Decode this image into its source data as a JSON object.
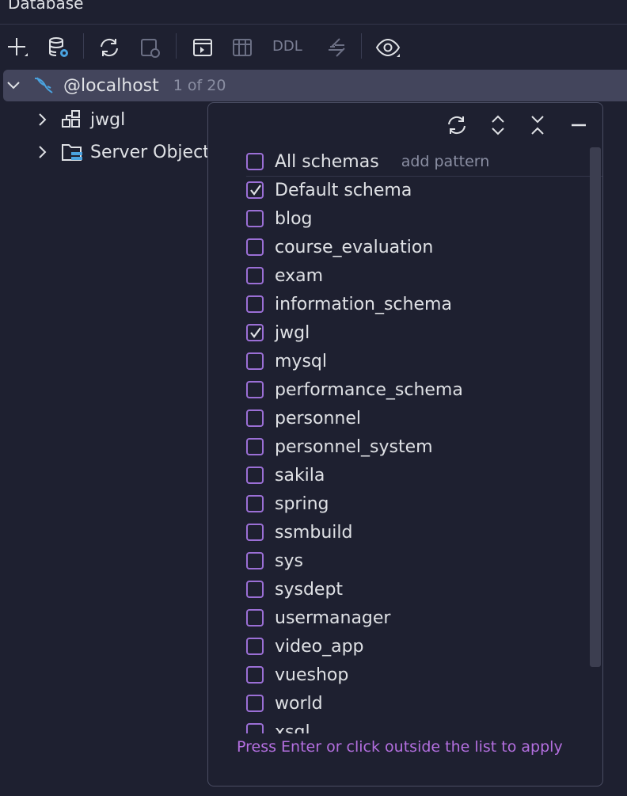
{
  "panel": {
    "title": "Database"
  },
  "toolbar": {
    "buttons": [
      {
        "icon": "plus-icon"
      },
      {
        "icon": "datasource-properties-icon"
      },
      {
        "icon": "refresh-icon"
      },
      {
        "icon": "stop-icon"
      },
      {
        "icon": "console-icon"
      },
      {
        "icon": "table-icon"
      },
      {
        "label": "DDL"
      },
      {
        "icon": "jump-to-source-icon"
      },
      {
        "icon": "view-options-icon"
      }
    ],
    "ddl_label": "DDL"
  },
  "tree": {
    "host": {
      "label": "@localhost",
      "count": "1 of 20"
    },
    "children": [
      {
        "label": "jwgl",
        "icon": "schema-icon"
      },
      {
        "label": "Server Objects",
        "icon": "server-objects-folder-icon"
      }
    ]
  },
  "schema_popup": {
    "tools": [
      "refresh-icon",
      "expand-icon",
      "collapse-icon",
      "minimize-icon"
    ],
    "all_schemas_label": "All schemas",
    "add_pattern_label": "add pattern",
    "items": [
      {
        "label": "Default schema",
        "checked": true
      },
      {
        "label": "blog",
        "checked": false
      },
      {
        "label": "course_evaluation",
        "checked": false
      },
      {
        "label": "exam",
        "checked": false
      },
      {
        "label": "information_schema",
        "checked": false
      },
      {
        "label": "jwgl",
        "checked": true
      },
      {
        "label": "mysql",
        "checked": false
      },
      {
        "label": "performance_schema",
        "checked": false
      },
      {
        "label": "personnel",
        "checked": false
      },
      {
        "label": "personnel_system",
        "checked": false
      },
      {
        "label": "sakila",
        "checked": false
      },
      {
        "label": "spring",
        "checked": false
      },
      {
        "label": "ssmbuild",
        "checked": false
      },
      {
        "label": "sys",
        "checked": false
      },
      {
        "label": "sysdept",
        "checked": false
      },
      {
        "label": "usermanager",
        "checked": false
      },
      {
        "label": "video_app",
        "checked": false
      },
      {
        "label": "vueshop",
        "checked": false
      },
      {
        "label": "world",
        "checked": false
      },
      {
        "label": "xsgl",
        "checked": false
      }
    ],
    "hint": "Press Enter or click outside the list to apply"
  },
  "colors": {
    "background": "#1e2030",
    "selection": "#43455c",
    "checkbox_accent": "#9b6fd6",
    "hint_text": "#b46fe0",
    "mysql_icon": "#4aa3e0"
  }
}
